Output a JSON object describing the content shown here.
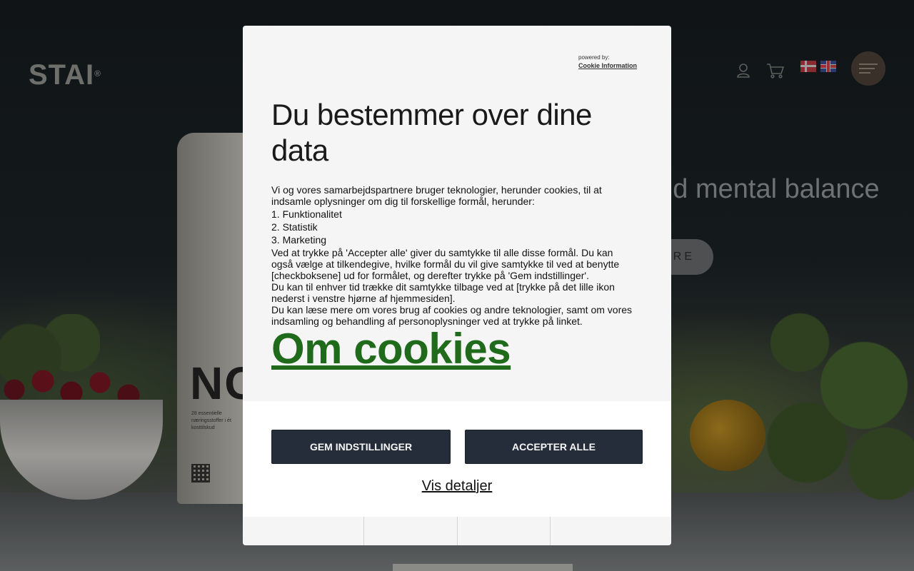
{
  "header": {
    "logo": "STAI",
    "logo_mark": "®",
    "icons": [
      "user-icon",
      "cart-icon",
      "menu-icon"
    ],
    "languages": [
      "Dansk",
      "English"
    ]
  },
  "hero": {
    "headline_fragment": "and mental balance",
    "button_fragment": "RE"
  },
  "product": {
    "bag_text": "NO",
    "bag_small_text": "28 essentielle næringsstoffer i ét kosttilskud"
  },
  "cookie_dialog": {
    "powered_by": "powered by:",
    "provider": "Cookie Information",
    "title": "Du bestemmer over dine data",
    "intro": "Vi og vores samarbejdspartnere bruger teknologier, herunder cookies, til at indsamle oplysninger om dig til forskellige formål, herunder:",
    "purposes": [
      "1. Funktionalitet",
      "2. Statistik",
      "3. Marketing"
    ],
    "consent_text": "Ved at trykke på 'Accepter alle' giver du samtykke til alle disse formål. Du kan også vælge at tilkendegive, hvilke formål du vil give samtykke til ved at benytte [checkboksene] ud for formålet, og derefter trykke på 'Gem indstillinger'.",
    "withdraw_text": "Du kan til enhver tid trække dit samtykke tilbage ved at [trykke på det lille ikon nederst i venstre hjørne af hjemmesiden].",
    "more_text": "Du kan læse mere om vores brug af cookies og andre teknologier, samt om vores indsamling og behandling af personoplysninger ved at trykke på linket.",
    "link_label": "Om cookies",
    "save_label": "GEM INDSTILLINGER",
    "accept_label": "ACCEPTER ALLE",
    "details_label": "Vis detaljer",
    "colors": {
      "button_bg": "#252d3b",
      "link": "#1f6b1b",
      "dialog_bg": "#f5f5f5"
    }
  }
}
